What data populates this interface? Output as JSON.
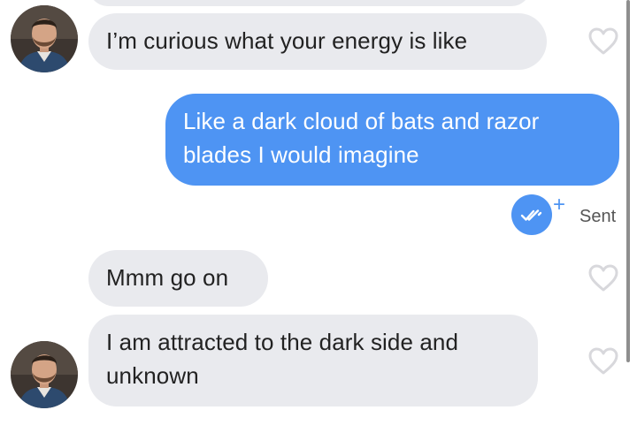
{
  "messages": [
    {
      "direction": "received",
      "text": "I’m curious what your energy is like"
    },
    {
      "direction": "sent",
      "text": "Like a dark cloud of bats and razor blades I would imagine"
    },
    {
      "direction": "received",
      "text": "Mmm go on"
    },
    {
      "direction": "received",
      "text": "I am attracted to the dark side and unknown"
    }
  ],
  "delivery_status": {
    "label": "Sent",
    "icon": "double-check-icon",
    "badge": "+"
  },
  "icons": {
    "like": "heart-outline-icon",
    "avatar": "contact-avatar"
  },
  "colors": {
    "sent_bubble": "#4e94f3",
    "received_bubble": "#e9eaee",
    "received_text": "#222222",
    "sent_text": "#ffffff",
    "heart_outline": "#d8d8dc",
    "status_text": "#555555"
  }
}
